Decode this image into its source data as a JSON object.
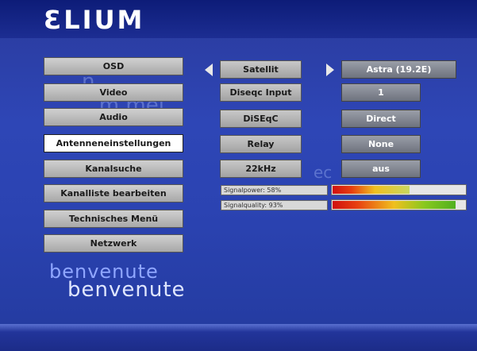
{
  "brand": {
    "logo_text": "ƐLIUM"
  },
  "watermark": {
    "line1": "...                n",
    "line2": "          ...m    mei",
    "line3": "ec"
  },
  "welcome": {
    "line1": "benvenute",
    "line2": "benvenute"
  },
  "menu": {
    "items": [
      {
        "label": "OSD",
        "active": false
      },
      {
        "label": "Video",
        "active": false
      },
      {
        "label": "Audio",
        "active": false
      },
      {
        "label": "Antenneneinstellungen",
        "active": true
      },
      {
        "label": "Kanalsuche",
        "active": false
      },
      {
        "label": "Kanalliste bearbeiten",
        "active": false
      },
      {
        "label": "Technisches Menü",
        "active": false
      },
      {
        "label": "Netzwerk",
        "active": false
      }
    ]
  },
  "settings": {
    "rows": [
      {
        "label": "Satellit",
        "value": "Astra (19.2E)"
      },
      {
        "label": "Diseqc Input",
        "value": "1"
      },
      {
        "label": "DiSEqC",
        "value": "Direct"
      },
      {
        "label": "Relay",
        "value": "None"
      },
      {
        "label": "22kHz",
        "value": "aus"
      }
    ]
  },
  "signal": {
    "power_label": "Signalpower: 58%",
    "power_percent": 58,
    "quality_label": "Signalquality: 93%",
    "quality_percent": 93
  },
  "colors": {
    "background": "#2e46b6",
    "top_bar": "#0d1c78",
    "button": "#b8b8b8",
    "value_box": "#7e838e"
  }
}
